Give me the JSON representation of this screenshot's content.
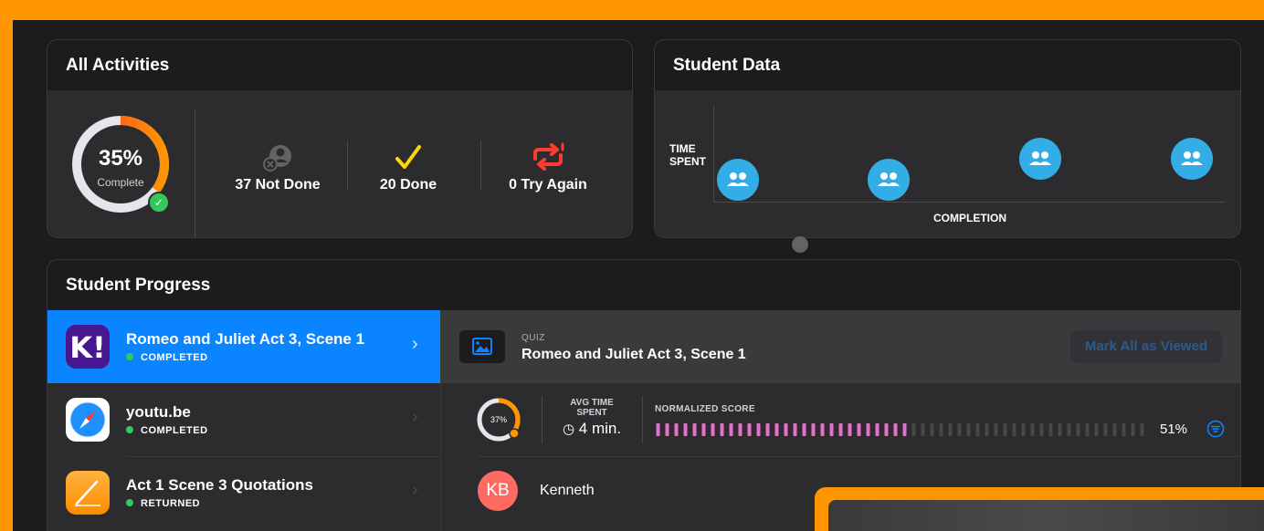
{
  "activities": {
    "title": "All Activities",
    "percent": "35%",
    "percent_sub": "Complete",
    "progress_fraction": 0.35,
    "stats": [
      {
        "label": "37 Not Done",
        "icon": "person-x-icon"
      },
      {
        "label": "20 Done",
        "icon": "checkmark-icon"
      },
      {
        "label": "0 Try Again",
        "icon": "retry-icon"
      }
    ]
  },
  "student_data": {
    "title": "Student Data",
    "ylabel": "TIME\nSPENT",
    "xlabel": "COMPLETION",
    "groups_icon": "group-icon"
  },
  "progress": {
    "title": "Student Progress",
    "activities": [
      {
        "title": "Romeo and Juliet Act 3, Scene 1",
        "status": "COMPLETED",
        "icon": "kahoot-icon",
        "selected": true
      },
      {
        "title": "youtu.be",
        "status": "COMPLETED",
        "icon": "safari-icon",
        "selected": false
      },
      {
        "title": "Act 1 Scene 3 Quotations",
        "status": "RETURNED",
        "icon": "pages-icon",
        "selected": false
      }
    ],
    "detail": {
      "kind": "QUIZ",
      "title": "Romeo and Juliet Act 3, Scene 1",
      "mark_button": "Mark All as Viewed",
      "completion_pct": "37%",
      "completion_fraction": 0.37,
      "avg_time_label": "AVG TIME\nSPENT",
      "avg_time_value": "4 min.",
      "normalized_score_label": "NORMALIZED SCORE",
      "normalized_score_value": "51%",
      "normalized_score_fraction": 0.51,
      "students": [
        {
          "initials": "KB",
          "name": "Kenneth"
        }
      ]
    }
  },
  "colors": {
    "accent": "#0a84ff",
    "frame": "#ff9500",
    "ring_red": "#ff3b30",
    "ring_orange": "#ff9500",
    "done_yellow": "#ffd60a",
    "bubble": "#32ade6",
    "score_pink": "#e86ed0",
    "status_green": "#34c759"
  }
}
